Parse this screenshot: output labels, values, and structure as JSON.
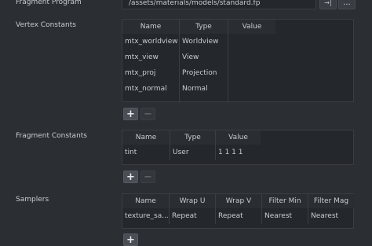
{
  "fragment_program": {
    "label": "Fragment Program",
    "value": "/assets/materials/models/standard.fp",
    "goto_icon": "→|",
    "browse_label": "..."
  },
  "vertex_constants": {
    "label": "Vertex Constants",
    "columns": [
      "Name",
      "Type",
      "Value"
    ],
    "rows": [
      {
        "name": "mtx_worldview",
        "type": "Worldview",
        "value": ""
      },
      {
        "name": "mtx_view",
        "type": "View",
        "value": ""
      },
      {
        "name": "mtx_proj",
        "type": "Projection",
        "value": ""
      },
      {
        "name": "mtx_normal",
        "type": "Normal",
        "value": ""
      }
    ],
    "add": "+",
    "remove": "−"
  },
  "fragment_constants": {
    "label": "Fragment Constants",
    "columns": [
      "Name",
      "Type",
      "Value"
    ],
    "rows": [
      {
        "name": "tint",
        "type": "User",
        "value": "1 1 1 1"
      }
    ],
    "add": "+",
    "remove": "−"
  },
  "samplers": {
    "label": "Samplers",
    "columns": [
      "Name",
      "Wrap U",
      "Wrap V",
      "Filter Min",
      "Filter Mag"
    ],
    "rows": [
      {
        "name": "texture_sa...",
        "wrap_u": "Repeat",
        "wrap_v": "Repeat",
        "filter_min": "Nearest",
        "filter_mag": "Nearest"
      }
    ],
    "add": "+"
  }
}
